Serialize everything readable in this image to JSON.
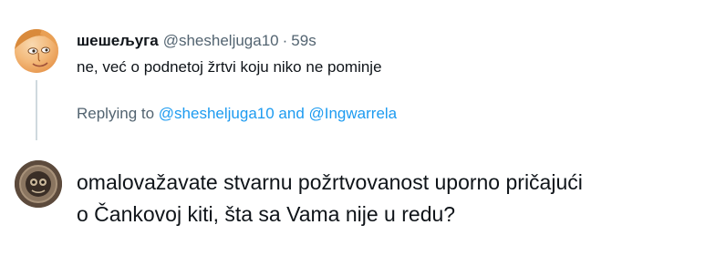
{
  "parent_tweet": {
    "display_name": "шешељуга",
    "handle": "@shesheljuga10",
    "separator": "·",
    "time": "59s",
    "text": "ne, već o podnetoj žrtvi koju niko ne pominje",
    "replying_prefix": "Replying to ",
    "replying_mention_1": "@shesheljuga10",
    "replying_conjunction": " and ",
    "replying_mention_2": "@Ingwarrela"
  },
  "reply_compose": {
    "text_line_1": "omalovažavate stvarnu požrtvovanost uporno pričajući",
    "text_line_2": "o Čankovoj kiti, šta sa Vama nije u redu?"
  },
  "colors": {
    "text_primary": "#0f1419",
    "text_secondary": "#536471",
    "link": "#1d9bf0",
    "thread_line": "#cfd9de"
  }
}
